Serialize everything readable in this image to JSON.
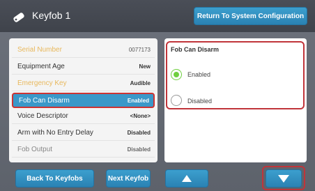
{
  "header": {
    "title": "Keyfob 1",
    "return_label": "Return To System Configuration",
    "icon": "key-icon"
  },
  "settings": [
    {
      "label": "Serial Number",
      "value": "0077173"
    },
    {
      "label": "Equipment Age",
      "value": "New"
    },
    {
      "label": "Emergency Key",
      "value": "Audible"
    },
    {
      "label": "Fob Can Disarm",
      "value": "Enabled"
    },
    {
      "label": "Voice Descriptor",
      "value": "<None>"
    },
    {
      "label": "Arm with No Entry Delay",
      "value": "Disabled"
    },
    {
      "label": "Fob Output",
      "value": "Disabled"
    }
  ],
  "detail": {
    "title": "Fob Can Disarm",
    "options": [
      "Enabled",
      "Disabled"
    ],
    "selected": "Enabled"
  },
  "footer": {
    "back_label": "Back To Keyfobs",
    "next_label": "Next Keyfob",
    "up_icon": "up-arrow-icon",
    "down_icon": "down-arrow-icon"
  },
  "colors": {
    "accent": "#2a82b3",
    "highlight": "#c0343a",
    "radio_on": "#6fcf3f"
  }
}
